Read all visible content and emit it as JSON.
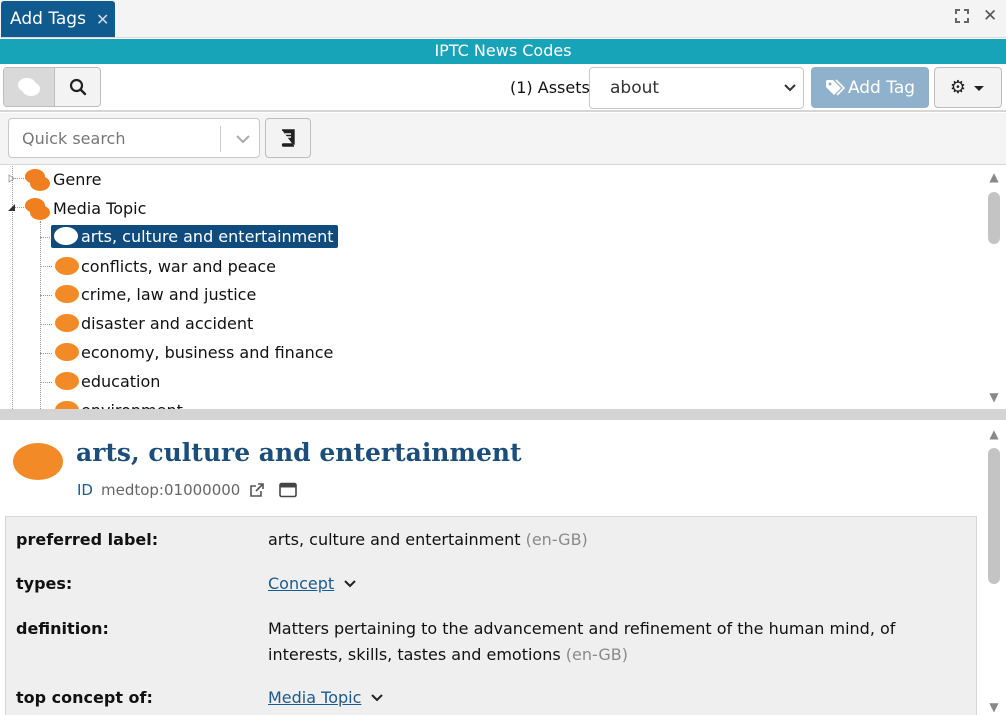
{
  "tab": {
    "label": "Add Tags",
    "close": "✕"
  },
  "window": {
    "expand_icon": "⛶",
    "close_icon": "✕"
  },
  "title": "IPTC News Codes",
  "toolbar": {
    "assets_label": "(1) Assets",
    "select_value": "about",
    "add_tag_label": "Add Tag"
  },
  "search": {
    "placeholder": "Quick search"
  },
  "tree": {
    "roots": [
      {
        "label": "Genre"
      },
      {
        "label": "Media Topic"
      }
    ],
    "children": [
      {
        "label": "arts, culture and entertainment",
        "selected": true
      },
      {
        "label": "conflicts, war and peace"
      },
      {
        "label": "crime, law and justice"
      },
      {
        "label": "disaster and accident"
      },
      {
        "label": "economy, business and finance"
      },
      {
        "label": "education"
      },
      {
        "label": "environment"
      }
    ]
  },
  "detail": {
    "title": "arts, culture and entertainment",
    "id_label": "ID",
    "id_value": "medtop:01000000",
    "properties": [
      {
        "label": "preferred label:",
        "value": "arts, culture and entertainment",
        "lang": "(en-GB)"
      },
      {
        "label": "types:",
        "value": "Concept"
      },
      {
        "label": "definition:",
        "value": "Matters pertaining to the advancement and refinement of the human mind, of interests, skills, tastes and emotions",
        "lang": "(en-GB)"
      },
      {
        "label": "top concept of:",
        "value": "Media Topic"
      }
    ]
  },
  "colors": {
    "accent": "#17a3b8",
    "primary": "#0f5a8e",
    "blob": "#f28b27"
  }
}
